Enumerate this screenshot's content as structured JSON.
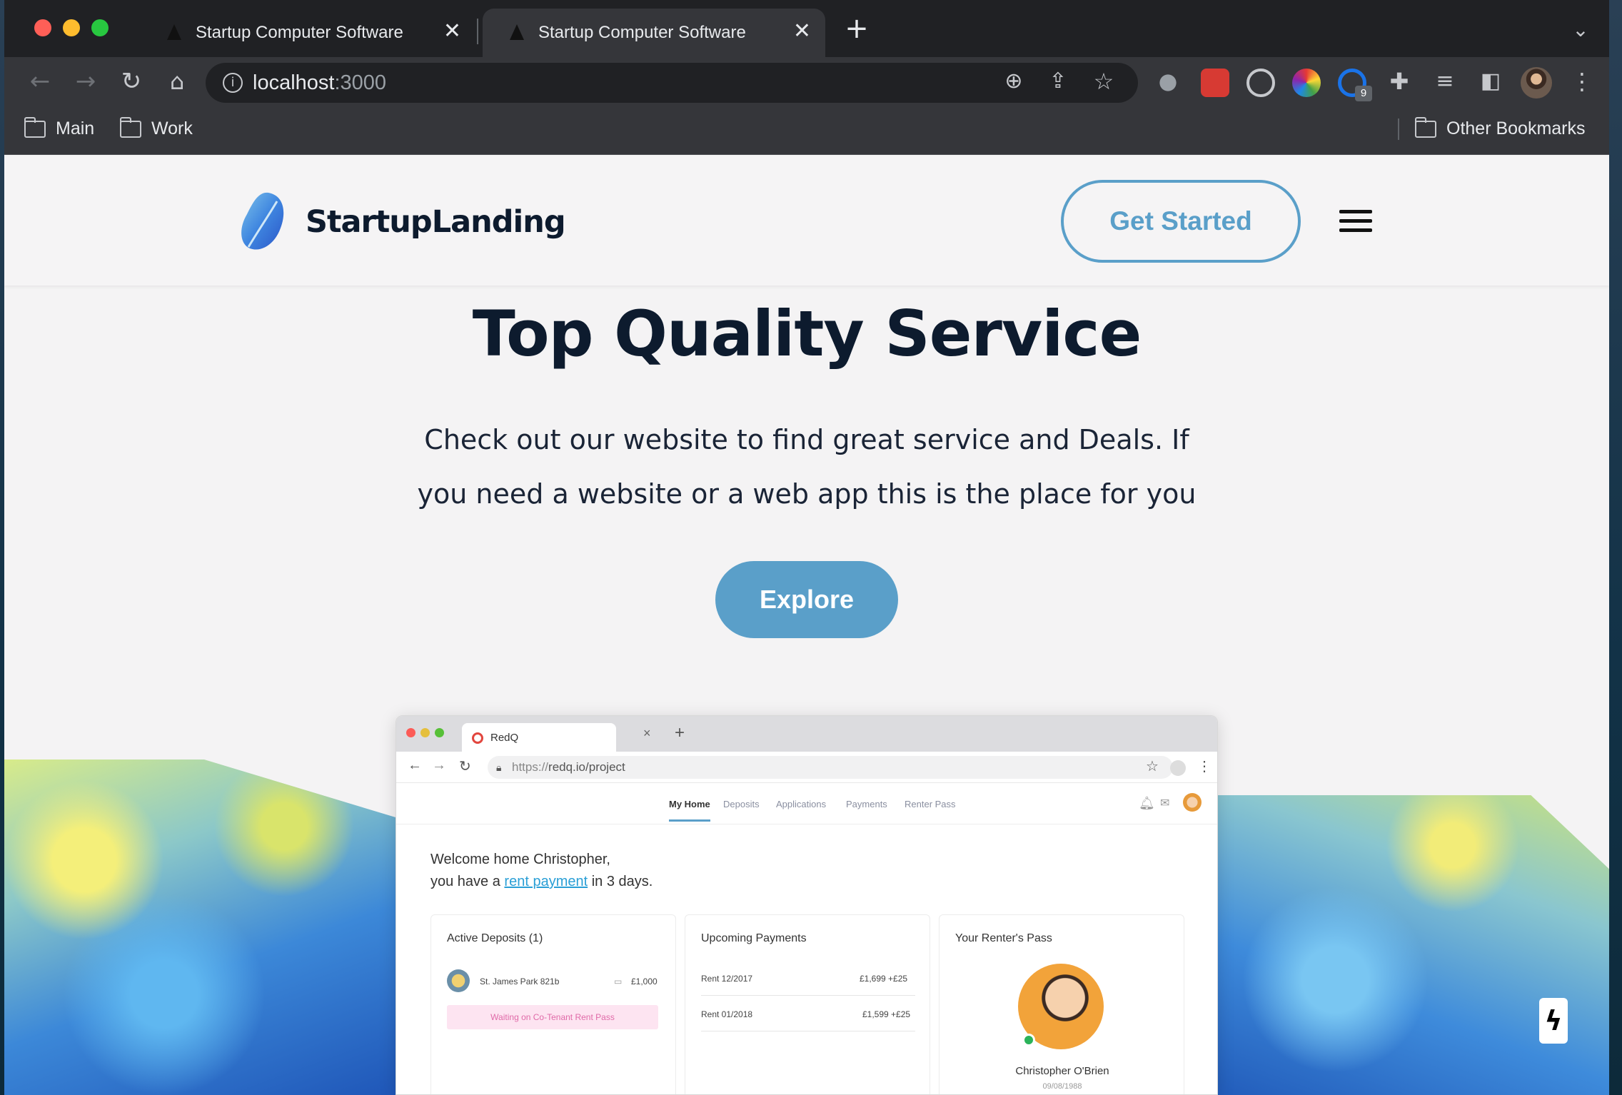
{
  "browser": {
    "tabs": [
      {
        "title": "Startup Computer Software",
        "active": false
      },
      {
        "title": "Startup Computer Software",
        "active": true
      }
    ],
    "new_tab_icon": "plus-icon",
    "url_host": "localhost",
    "url_port": ":3000",
    "extension_badge_count": "9",
    "bookmarks": [
      "Main",
      "Work"
    ],
    "other_bookmarks": "Other Bookmarks"
  },
  "site": {
    "brand": "StartupLanding",
    "get_started": "Get Started",
    "headline": "Top Quality Service",
    "subtext": "Check out our website to find great service and Deals. If you need a website or a web app this is the place for you",
    "explore": "Explore"
  },
  "mockup": {
    "tab_title": "RedQ",
    "url_prefix": "https://",
    "url_rest": "redq.io/project",
    "nav": [
      "My Home",
      "Deposits",
      "Applications",
      "Payments",
      "Renter Pass"
    ],
    "welcome_line1": "Welcome home Christopher,",
    "welcome_pre": "you have a ",
    "welcome_link": "rent payment",
    "welcome_post": " in 3 days.",
    "cards": {
      "deposits": {
        "title": "Active Deposits (1)",
        "property": "St. James Park 821b",
        "amount": "£1,000",
        "status": "Waiting on Co-Tenant Rent Pass"
      },
      "payments": {
        "title": "Upcoming Payments",
        "rows": [
          {
            "label": "Rent 12/2017",
            "amount": "£1,699 +£25"
          },
          {
            "label": "Rent 01/2018",
            "amount": "£1,599 +£25"
          }
        ]
      },
      "pass": {
        "title": "Your Renter's Pass",
        "name": "Christopher O'Brien",
        "dob": "09/08/1988"
      }
    }
  },
  "colors": {
    "accent": "#5a9fc9",
    "heading": "#0d1b2e",
    "page_bg": "#f4f3f4",
    "chrome_dark": "#202124"
  }
}
